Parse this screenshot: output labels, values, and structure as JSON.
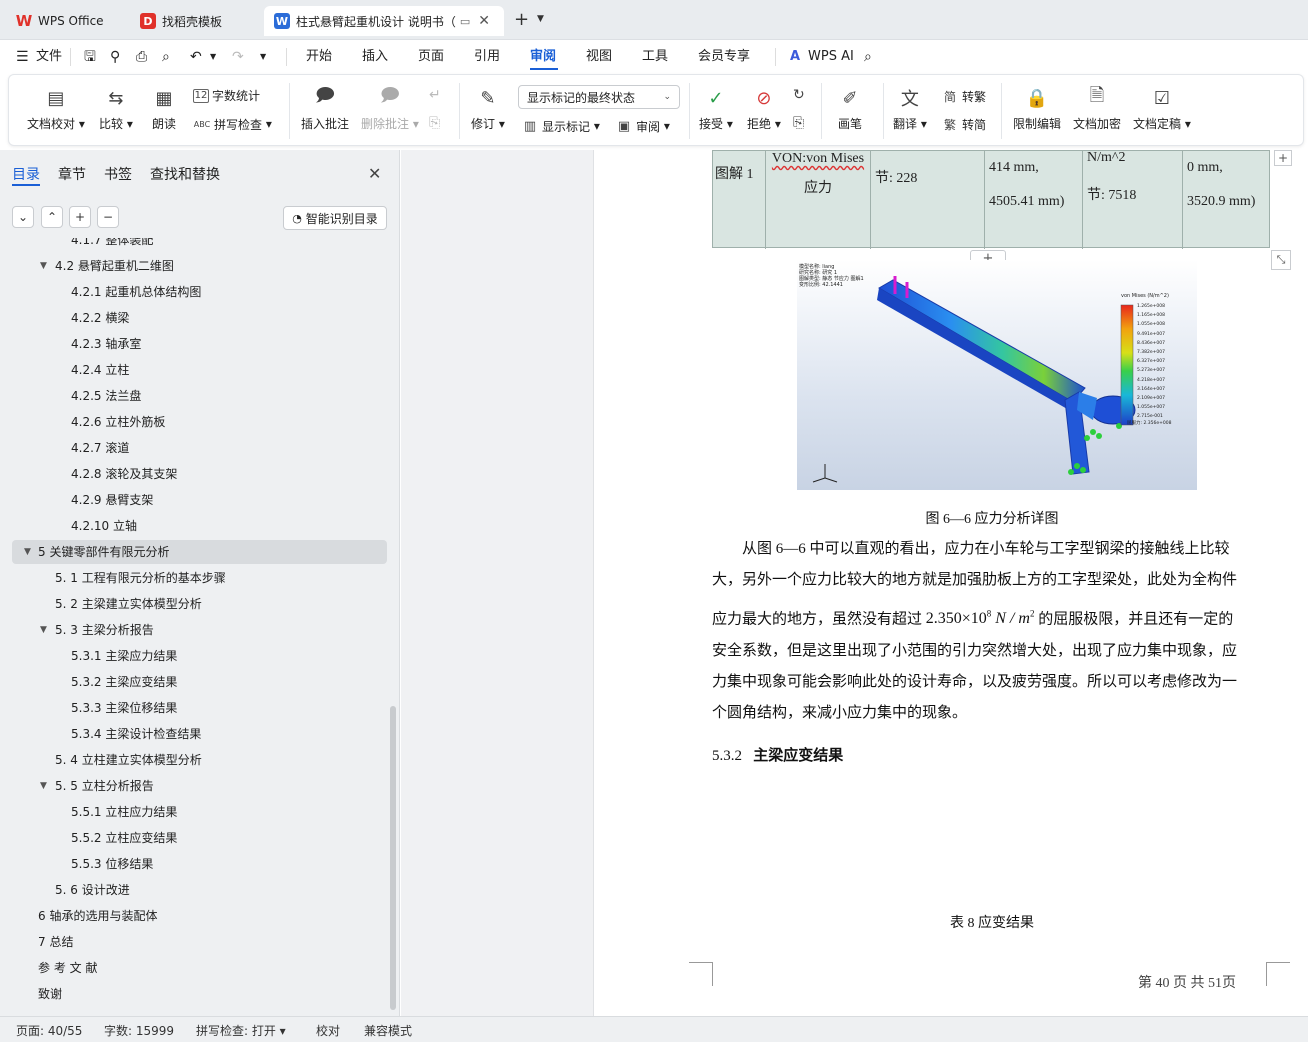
{
  "tabs": [
    {
      "label": "WPS Office",
      "icon": "wps-logo-icon"
    },
    {
      "label": "找稻壳模板",
      "icon": "docer-icon"
    },
    {
      "label": "柱式悬臂起重机设计 说明书（",
      "icon": "word-doc-icon"
    }
  ],
  "menu": {
    "file": "文件",
    "items": [
      "开始",
      "插入",
      "页面",
      "引用",
      "审阅",
      "视图",
      "工具",
      "会员专享"
    ],
    "active": "审阅",
    "wps_ai": "WPS AI"
  },
  "ribbon": {
    "doc_check": "文档校对",
    "compare": "比较",
    "read_aloud": "朗读",
    "word_count": "字数统计",
    "spell_check": "拼写检查",
    "insert_comment": "插入批注",
    "delete_comment": "删除批注",
    "revise": "修订",
    "display_select": "显示标记的最终状态",
    "show_markup": "显示标记",
    "review": "审阅",
    "accept": "接受",
    "reject": "拒绝",
    "pen": "画笔",
    "translate": "翻译",
    "to_traditional": "转繁",
    "to_simplified": "转简",
    "restrict_edit": "限制编辑",
    "encrypt": "文档加密",
    "finalize": "文档定稿"
  },
  "panel": {
    "tabs": [
      "目录",
      "章节",
      "书签",
      "查找和替换"
    ],
    "smart_toc": "智能识别目录",
    "toc": [
      {
        "text": "4.1.7  整体装配",
        "level": 3,
        "arrow": ""
      },
      {
        "text": "4.2   悬臂起重机二维图",
        "level": 2,
        "arrow": "down"
      },
      {
        "text": "4.2.1 起重机总体结构图",
        "level": 3,
        "arrow": ""
      },
      {
        "text": "4.2.2 横梁",
        "level": 3,
        "arrow": ""
      },
      {
        "text": "4.2.3 轴承室",
        "level": 3,
        "arrow": ""
      },
      {
        "text": "4.2.4 立柱",
        "level": 3,
        "arrow": ""
      },
      {
        "text": "4.2.5 法兰盘",
        "level": 3,
        "arrow": ""
      },
      {
        "text": "4.2.6 立柱外筋板",
        "level": 3,
        "arrow": ""
      },
      {
        "text": "4.2.7 滚道",
        "level": 3,
        "arrow": ""
      },
      {
        "text": "4.2.8 滚轮及其支架",
        "level": 3,
        "arrow": ""
      },
      {
        "text": "4.2.9 悬臂支架",
        "level": 3,
        "arrow": ""
      },
      {
        "text": "4.2.10 立轴",
        "level": 3,
        "arrow": ""
      },
      {
        "text": "5   关键零部件有限元分析",
        "level": 1,
        "arrow": "down",
        "selected": true
      },
      {
        "text": "5. 1   工程有限元分析的基本步骤",
        "level": 2,
        "arrow": ""
      },
      {
        "text": "5. 2   主梁建立实体模型分析",
        "level": 2,
        "arrow": ""
      },
      {
        "text": "5. 3   主梁分析报告",
        "level": 2,
        "arrow": "down"
      },
      {
        "text": "5.3.1   主梁应力结果",
        "level": 3,
        "arrow": ""
      },
      {
        "text": "5.3.2   主梁应变结果",
        "level": 3,
        "arrow": ""
      },
      {
        "text": "5.3.3   主梁位移结果",
        "level": 3,
        "arrow": ""
      },
      {
        "text": "5.3.4   主梁设计检查结果",
        "level": 3,
        "arrow": ""
      },
      {
        "text": "5. 4   立柱建立实体模型分析",
        "level": 2,
        "arrow": ""
      },
      {
        "text": "5. 5   立柱分析报告",
        "level": 2,
        "arrow": "down"
      },
      {
        "text": "5.5.1   立柱应力结果",
        "level": 3,
        "arrow": ""
      },
      {
        "text": "5.5.2   立柱应变结果",
        "level": 3,
        "arrow": ""
      },
      {
        "text": "5.5.3   位移结果",
        "level": 3,
        "arrow": ""
      },
      {
        "text": "5. 6   设计改进",
        "level": 2,
        "arrow": ""
      },
      {
        "text": "6   轴承的选用与装配体",
        "level": 1,
        "arrow": ""
      },
      {
        "text": "7   总结",
        "level": 1,
        "arrow": ""
      },
      {
        "text": "参 考 文 献",
        "level": 1,
        "arrow": ""
      },
      {
        "text": "致谢",
        "level": 1,
        "arrow": ""
      }
    ]
  },
  "doc": {
    "table": {
      "c1": "图解 1",
      "c2a": "VON:von   Mises",
      "c2b": "应力",
      "c3": "节: 228",
      "c4a": "414 mm,",
      "c4b": "4505.41 mm)",
      "c5a": "N/m^2",
      "c5b": "节: 7518",
      "c6a": "0 mm,",
      "c6b": "3520.9 mm)"
    },
    "figure_caption": "图 6—6    应力分析详图",
    "para_line1": "从图 6—6 中可以直观的看出，应力在小车轮与工字型钢梁的接触线上比较",
    "para_line2": "大，另外一个应力比较大的地方就是加强肋板上方的工字型梁处，此处为全构件",
    "para_line3a": "应力最大的地方，虽然没有超过",
    "formula": "2.350×10",
    "formula_exp": "8",
    "formula_unit": " N / m",
    "formula_unit_exp": "2",
    "para_line3b": "的屈服极限，并且还有一定的",
    "para_line4": "安全系数，但是这里出现了小范围的引力突然增大处，出现了应力集中现象，应",
    "para_line5": "力集中现象可能会影响此处的设计寿命，以及疲劳强度。所以可以考虑修改为一",
    "para_line6": "个圆角结构，来减小应力集中的现象。",
    "heading_num": "5.3.2",
    "heading_text": "主梁应变结果",
    "table_caption": "表 8  应变结果",
    "page_indicator": "第  40  页  共 51页",
    "fea_legend_title": "von Mises (N/m^2)",
    "fea_legend_values": [
      "1.265e+008",
      "1.165e+008",
      "1.055e+008",
      "9.491e+007",
      "8.436e+007",
      "7.382e+007",
      "6.327e+007",
      "5.273e+007",
      "4.218e+007",
      "3.164e+007",
      "2.109e+007",
      "1.055e+007",
      "2.715e-001"
    ],
    "fea_yield": "屈服力: 2.356e+008",
    "fea_info": [
      "模型名称: liang",
      "研究名称: 研究 1",
      "图解类型: 静态 节应力 图解1",
      "变形比例: 42.1441"
    ]
  },
  "status": {
    "page": "页面: 40/55",
    "words": "字数: 15999",
    "spell": "拼写检查: 打开",
    "proof": "校对",
    "compat": "兼容模式"
  }
}
